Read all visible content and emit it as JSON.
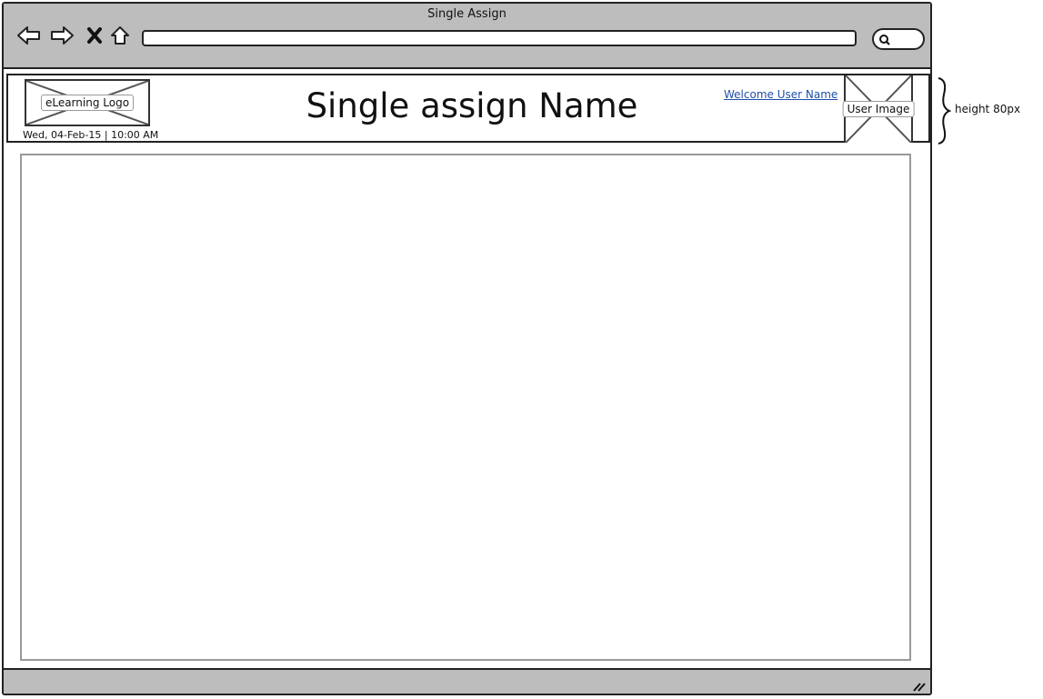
{
  "window": {
    "title": "Single Assign",
    "chrome_color": "#bdbdbd",
    "nav_icons": [
      "back-arrow-icon",
      "forward-arrow-icon",
      "close-x-icon",
      "home-icon"
    ],
    "url": "",
    "search_icon": "magnifier-icon"
  },
  "header": {
    "logo_label": "eLearning Logo",
    "datetime": "Wed, 04-Feb-15 | 10:00 AM",
    "title": "Single assign Name",
    "welcome_link": "Welcome User Name",
    "welcome_color": "#1f4fa8",
    "user_image_label": "User Image"
  },
  "annotation": {
    "header_height": "height 80px"
  }
}
